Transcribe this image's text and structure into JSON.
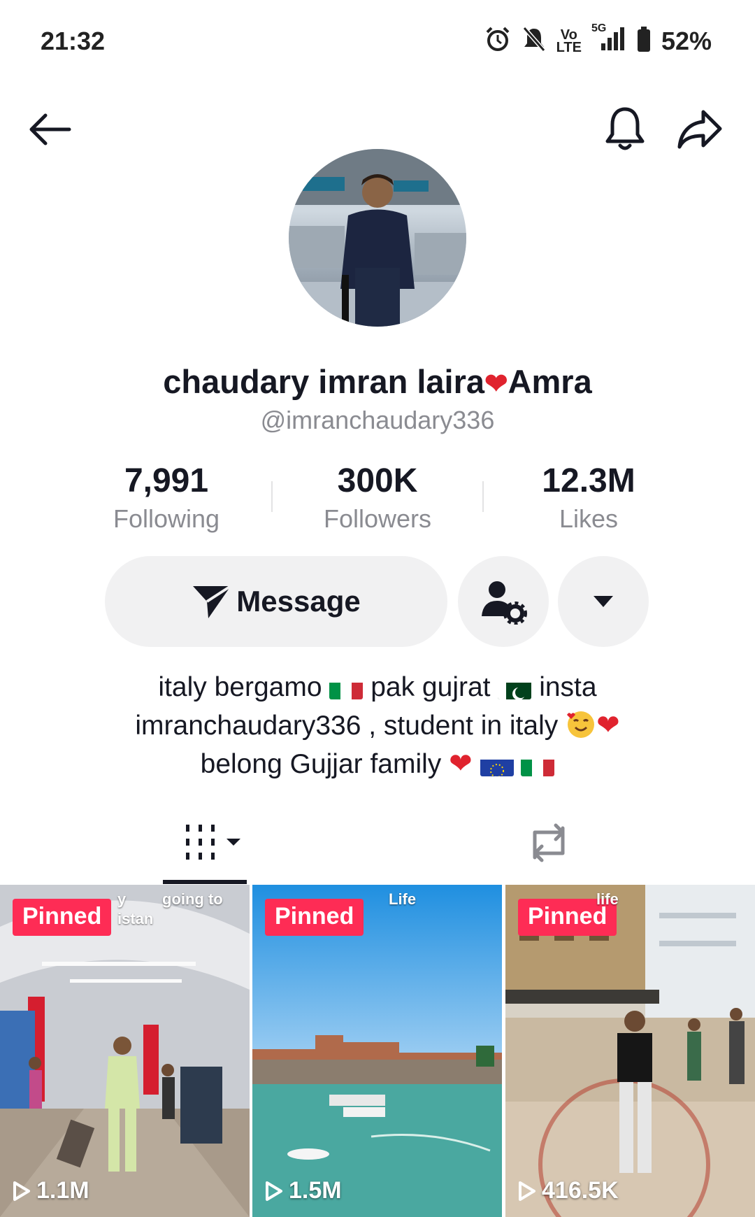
{
  "status_bar": {
    "time": "21:32",
    "volte_top": "Vo",
    "volte_bottom": "LTE",
    "network": "5G",
    "battery": "52%",
    "icons": [
      "alarm-icon",
      "mute-bell-icon",
      "volte-icon",
      "signal-icon",
      "battery-icon"
    ]
  },
  "topbar": {
    "icons": [
      "back-arrow-icon",
      "bell-icon",
      "share-icon"
    ]
  },
  "profile": {
    "name_part1": "chaudary imran laira",
    "name_part2": "Amra",
    "handle": "@imranchaudary336"
  },
  "stats": [
    {
      "value": "7,991",
      "label": "Following"
    },
    {
      "value": "300K",
      "label": "Followers"
    },
    {
      "value": "12.3M",
      "label": "Likes"
    }
  ],
  "actions": {
    "message_label": "Message",
    "icons": [
      "send-icon",
      "user-settings-icon",
      "caret-down-icon"
    ]
  },
  "bio": {
    "line1_a": "italy bergamo",
    "line1_b": "pak gujrat",
    "line1_c": "insta",
    "line2": "imranchaudary336  , student in italy",
    "line3": "belong Gujjar family"
  },
  "tabs": {
    "icons": [
      "grid-videos-icon",
      "repost-icon"
    ]
  },
  "videos": [
    {
      "pinned": "Pinned",
      "views": "1.1M",
      "caption_top": "y",
      "caption_right": "going to",
      "caption_bottom": "istan"
    },
    {
      "pinned": "Pinned",
      "views": "1.5M",
      "caption_right": "Life"
    },
    {
      "pinned": "Pinned",
      "views": "416.5K",
      "caption_right": "life"
    }
  ],
  "colors": {
    "accent": "#fe2c55",
    "text": "#161823",
    "secondary_text": "#8a8b91",
    "button_bg": "#f1f1f2"
  }
}
